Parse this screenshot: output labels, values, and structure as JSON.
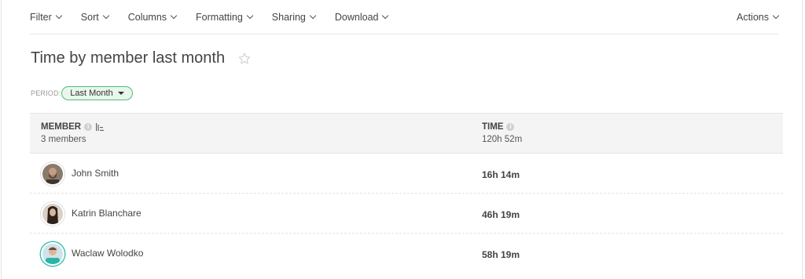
{
  "toolbar": {
    "menus": [
      "Filter",
      "Sort",
      "Columns",
      "Formatting",
      "Sharing",
      "Download"
    ],
    "actions": "Actions"
  },
  "report": {
    "title": "Time by member last month",
    "period_label": "PERIOD:",
    "period_value": "Last Month"
  },
  "table": {
    "columns": [
      {
        "header": "MEMBER",
        "summary": "3 members"
      },
      {
        "header": "TIME",
        "summary": "120h 52m"
      }
    ],
    "rows": [
      {
        "member": "John Smith",
        "time": "16h 14m",
        "avatar": "bearded-man"
      },
      {
        "member": "Katrin Blanchare",
        "time": "46h 19m",
        "avatar": "woman-dark-hair"
      },
      {
        "member": "Waclaw Wolodko",
        "time": "58h 19m",
        "avatar": "man-teal-shirt"
      }
    ]
  },
  "colors": {
    "accent_green": "#4fbd76",
    "pill_bg": "#e8f6ec",
    "header_bg": "#f4f4f4",
    "avatar_ring_teal": "#3cc0b3"
  }
}
